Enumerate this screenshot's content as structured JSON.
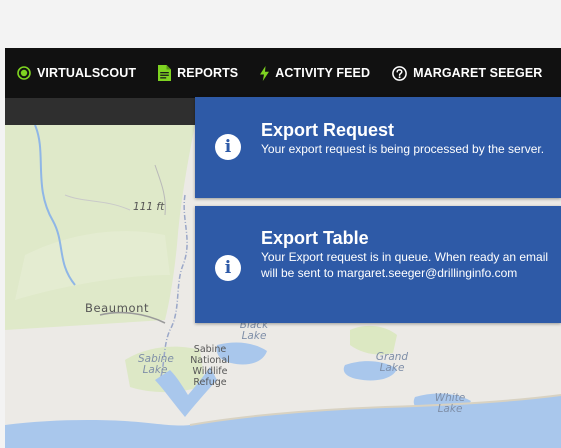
{
  "nav": {
    "items": [
      {
        "label": "VIRTUALSCOUT",
        "icon": "radio-target-icon"
      },
      {
        "label": "REPORTS",
        "icon": "document-icon"
      },
      {
        "label": "ACTIVITY FEED",
        "icon": "lightning-icon"
      },
      {
        "label": "MARGARET SEEGER",
        "icon": "help-circle-icon"
      }
    ]
  },
  "map": {
    "labels": {
      "contour": "111 ft",
      "city": "Beaumont",
      "black_lake": "Black Lake",
      "sabine_lake": "Sabine Lake",
      "refuge": "Sabine National Wildlife Refuge",
      "grand_lake": "Grand Lake",
      "white_lake": "White Lake"
    },
    "toolbar_icons": [
      "undo-icon",
      "filter-icon",
      "zoom-icon",
      "cube-icon",
      "pin-icon",
      "location-icon"
    ]
  },
  "notifications": [
    {
      "title": "Export Request",
      "body": "Your export request is being processed by the server.",
      "icon": "info-icon"
    },
    {
      "title": "Export Table",
      "body": "Your Export request is in queue. When ready an email will be sent to margaret.seeger@drillinginfo.com",
      "icon": "info-icon"
    }
  ],
  "colors": {
    "navbar": "#111111",
    "accent_green": "#7ed321",
    "notice_blue": "#2e5aa7",
    "land": "#eceae6",
    "water": "#a9c7ec",
    "green_area": "#dce8c2"
  }
}
